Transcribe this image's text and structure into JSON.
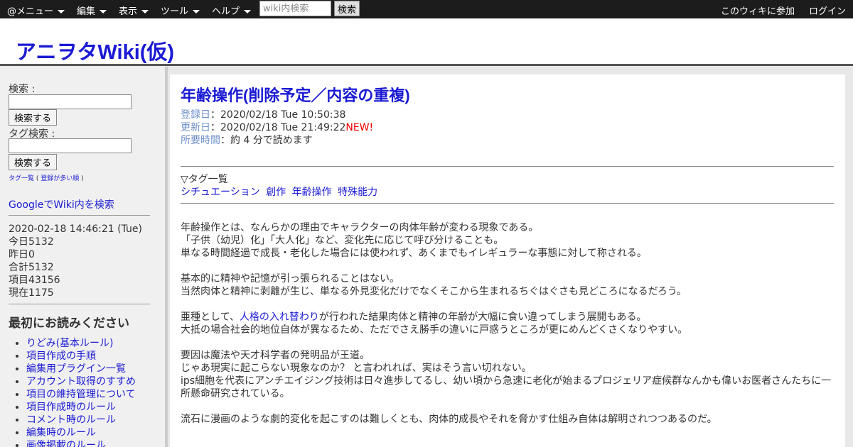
{
  "topbar": {
    "menus": [
      "@メニュー",
      "編集",
      "表示",
      "ツール",
      "ヘルプ"
    ],
    "search_placeholder": "wiki内検索",
    "search_button": "検索",
    "join": "このウィキに参加",
    "login": "ログイン"
  },
  "site": {
    "title": "アニヲタWiki(仮)"
  },
  "sidebar": {
    "search_label": "検索 :",
    "search_button": "検索する",
    "tag_search_label": "タグ検索 :",
    "tag_search_button": "検索する",
    "tag_list": "タグ一覧",
    "tag_list_open": "(",
    "tag_list_popular": "登録が多い順",
    "tag_list_close": ")",
    "google_search": "GoogleでWiki内を検索",
    "counters": {
      "datetime": "2020-02-18 14:46:21 (Tue)",
      "today": "今日5132",
      "yesterday": "昨日0",
      "total": "合計5132",
      "items": "項目43156",
      "now": "現在1175"
    },
    "read_first_title": "最初にお読みください",
    "read_first_items": [
      "りどみ(基本ルール)",
      "項目作成の手順",
      "編集用プラグイン一覧",
      "アカウント取得のすすめ",
      "項目の維持管理について",
      "項目作成時のルール",
      "コメント時のルール",
      "編集時のルール",
      "画像掲載のルール"
    ]
  },
  "page": {
    "title": "年齢操作(削除予定／内容の重複)",
    "meta": {
      "registered_label": "登録日",
      "registered_value": "：2020/02/18 Tue 10:50:38",
      "updated_label": "更新日",
      "updated_value": "：2020/02/18 Tue 21:49:22",
      "new_badge": "NEW!",
      "reading_label": "所要時間",
      "reading_value": "：約 4 分で読めます"
    },
    "tags_heading": "▽タグ一覧",
    "tags": [
      "シチュエーション",
      "創作",
      "年齢操作",
      "特殊能力"
    ],
    "body": {
      "p1_l1": "年齢操作とは、なんらかの理由でキャラクターの肉体年齢が変わる現象である。",
      "p1_l2": "「子供（幼児）化」「大人化」など、変化先に応じて呼び分けることも。",
      "p1_l3": "単なる時間経過で成長・老化した場合には使われず、あくまでもイレギュラーな事態に対して称される。",
      "p2_l1": "基本的に精神や記憶が引っ張られることはない。",
      "p2_l2": "当然肉体と精神に剥離が生じ、単なる外見変化だけでなくそこから生まれるちぐはぐさも見どころになるだろう。",
      "p3_l1_pre": "亜種として、",
      "p3_l1_link": "人格の入れ替わり",
      "p3_l1_post": "が行われた結果肉体と精神の年齢が大幅に食い違ってしまう展開もある。",
      "p3_l2": "大抵の場合社会的地位自体が異なるため、ただでさえ勝手の違いに戸惑うところが更にめんどくさくなりやすい。",
      "p4_l1": "要因は魔法や天才科学者の発明品が王道。",
      "p4_l2": "じゃあ現実に起こらない現象なのか？ と言われれば、実はそう言い切れない。",
      "p4_l3": "ips細胞を代表にアンチエイジング技術は日々進歩してるし、幼い頃から急速に老化が始まるプロジェリア症候群なんかも偉いお医者さんたちに一所懸命研究されている。",
      "p5_l1": "流石に漫画のような劇的変化を起こすのは難しくとも、肉体的成長やそれを脅かす仕組み自体は解明されつつあるのだ。"
    }
  }
}
